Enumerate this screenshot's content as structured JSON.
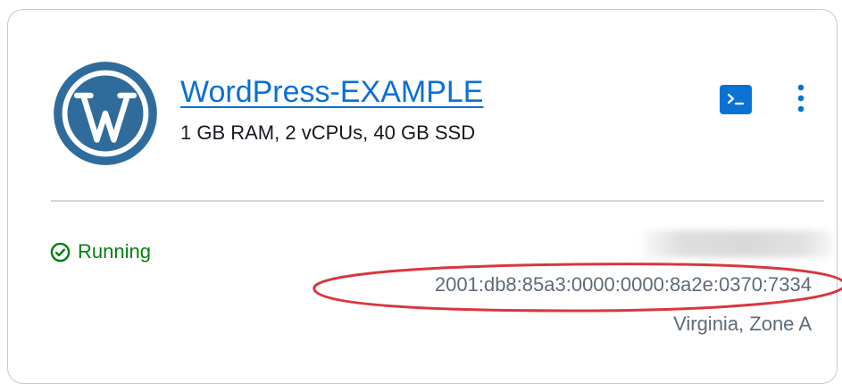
{
  "instance": {
    "name": "WordPress-EXAMPLE",
    "specs": "1 GB RAM, 2 vCPUs, 40 GB SSD",
    "status": "Running",
    "ipv6_address": "2001:db8:85a3:0000:0000:8a2e:0370:7334",
    "location": "Virginia, Zone A",
    "logo_icon": "wordpress-logo",
    "terminal_icon": "terminal-icon",
    "menu_icon": "more-vertical-icon"
  },
  "colors": {
    "link": "#0a6fd6",
    "status_running": "#037f0c",
    "terminal_button": "#0972d3",
    "annotation": "#d9363e",
    "wordpress_blue": "#21759b"
  }
}
